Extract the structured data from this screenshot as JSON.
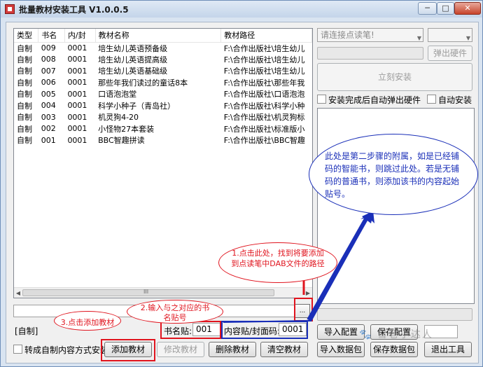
{
  "window": {
    "title": "批量教材安装工具 V1.0.0.5",
    "min_glyph": "─",
    "max_glyph": "□",
    "close_glyph": "✕",
    "icon": "app-icon"
  },
  "list": {
    "headers": [
      "类型",
      "书名",
      "内/封",
      "教材名称",
      "教材路径"
    ],
    "rows": [
      [
        "自制",
        "009",
        "0001",
        "培生幼儿英语预备级",
        "F:\\合作出版社\\培生幼儿"
      ],
      [
        "自制",
        "008",
        "0001",
        "培生幼儿英语提高级",
        "F:\\合作出版社\\培生幼儿"
      ],
      [
        "自制",
        "007",
        "0001",
        "培生幼儿英语基础级",
        "F:\\合作出版社\\培生幼儿"
      ],
      [
        "自制",
        "006",
        "0001",
        "那些年我们读过的童话8本",
        "F:\\合作出版社\\那些年我"
      ],
      [
        "自制",
        "005",
        "0001",
        "口语泡泡堂",
        "F:\\合作出版社\\口语泡泡"
      ],
      [
        "自制",
        "004",
        "0001",
        "科学小种子（青岛社）",
        "F:\\合作出版社\\科学小种"
      ],
      [
        "自制",
        "003",
        "0001",
        "机灵狗4-20",
        "F:\\合作出版社\\机灵狗标"
      ],
      [
        "自制",
        "002",
        "0001",
        "小怪物27本套装",
        "F:\\合作出版社\\标准版小"
      ],
      [
        "自制",
        "001",
        "0001",
        "BBC智趣拼读",
        "F:\\合作出版社\\BBC智趣"
      ]
    ],
    "scroll_grip": "III",
    "scroll_left": "◀",
    "scroll_right": "▶"
  },
  "path_input": {
    "value": ""
  },
  "browse_button": {
    "label": "..."
  },
  "type_tag": "[自制]",
  "book_id": {
    "label": "书名贴:",
    "value": "001"
  },
  "content_id": {
    "label": "内容贴/封面码:",
    "value": "0001"
  },
  "bottom_left": {
    "convert_checkbox_label": "转成自制内容方式安装",
    "add_button": "添加教材",
    "modify_button": "修改教材",
    "delete_button": "删除教材",
    "clear_button": "清空教材"
  },
  "right_panel": {
    "pen_combo_placeholder": "请连接点读笔!",
    "second_combo_value": "",
    "eject_button": "弹出硬件",
    "install_now_button": "立刻安装",
    "auto_eject_label": "安装完成后自动弹出硬件",
    "auto_install_label": "自动安装",
    "import_config_button": "导入配置",
    "save_config_button": "保存配置",
    "import_package_button": "导入数据包",
    "save_package_button": "保存数据包",
    "exit_button": "退出工具"
  },
  "annotations": {
    "note1": "1.点击此处，找到将要添加到点读笔中DAB文件的路径",
    "note2": "2.输入与之对应的书名贴号",
    "note3": "3.点击添加教材",
    "note_blue": "此处是第二步骤的附属，如是已经铺码的智能书，则跳过此处。若是无铺码的普通书，则添加该书的内容起始贴号。"
  },
  "watermark": "🐾 雪巷小达人",
  "colors": {
    "annotation_red": "#e0141e",
    "annotation_blue": "#1a2fb8",
    "window_frame": "#d9e4f1"
  }
}
